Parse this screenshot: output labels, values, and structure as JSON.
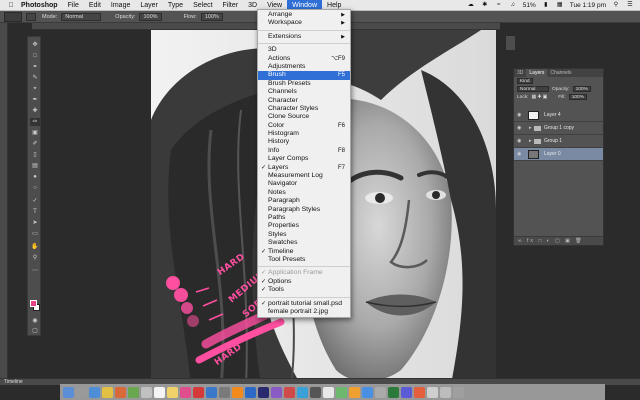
{
  "menubar": {
    "app_name": "Photoshop",
    "items": [
      "File",
      "Edit",
      "Image",
      "Layer",
      "Type",
      "Select",
      "Filter",
      "3D",
      "View",
      "Window",
      "Help"
    ],
    "battery": "51%",
    "clock": "Tue 1:19 pm"
  },
  "options_bar": {
    "mode_label": "Mode:",
    "mode_value": "Normal",
    "opacity_label": "Opacity:",
    "opacity_value": "100%",
    "flow_label": "Flow:",
    "flow_value": "100%"
  },
  "window_menu": {
    "rows": [
      {
        "label": "Arrange",
        "arrow": true
      },
      {
        "label": "Workspace",
        "arrow": true
      },
      {
        "sep": true
      },
      {
        "label": "Extensions",
        "arrow": true
      },
      {
        "sep": true
      },
      {
        "label": "3D"
      },
      {
        "label": "Actions",
        "shortcut": "⌥F9"
      },
      {
        "label": "Adjustments"
      },
      {
        "label": "Brush",
        "shortcut": "F5",
        "highlighted": true
      },
      {
        "label": "Brush Presets"
      },
      {
        "label": "Channels"
      },
      {
        "label": "Character"
      },
      {
        "label": "Character Styles"
      },
      {
        "label": "Clone Source"
      },
      {
        "label": "Color",
        "shortcut": "F6"
      },
      {
        "label": "Histogram"
      },
      {
        "label": "History"
      },
      {
        "label": "Info",
        "shortcut": "F8"
      },
      {
        "label": "Layer Comps"
      },
      {
        "label": "Layers",
        "shortcut": "F7",
        "checked": true
      },
      {
        "label": "Measurement Log"
      },
      {
        "label": "Navigator"
      },
      {
        "label": "Notes"
      },
      {
        "label": "Paragraph"
      },
      {
        "label": "Paragraph Styles"
      },
      {
        "label": "Paths"
      },
      {
        "label": "Properties"
      },
      {
        "label": "Styles"
      },
      {
        "label": "Swatches"
      },
      {
        "label": "Timeline",
        "checked": true
      },
      {
        "label": "Tool Presets"
      },
      {
        "sep": true
      },
      {
        "label": "Application Frame",
        "checked": true,
        "disabled": true
      },
      {
        "label": "Options",
        "checked": true
      },
      {
        "label": "Tools",
        "checked": true
      },
      {
        "sep": true
      },
      {
        "label": "portrait tutorial small.psd",
        "checked": true
      },
      {
        "label": "female portrait 2.jpg"
      }
    ]
  },
  "layers_panel": {
    "tabs": [
      "3D",
      "Layers",
      "Channels"
    ],
    "kind": "Kind",
    "blend_mode": "Normal",
    "opacity_label": "Opacity:",
    "opacity_value": "100%",
    "lock_label": "Lock:",
    "fill_label": "Fill:",
    "fill_value": "100%",
    "layers": [
      {
        "name": "Layer 4",
        "type": "layer"
      },
      {
        "name": "Group 1 copy",
        "type": "group"
      },
      {
        "name": "Group 1",
        "type": "group"
      },
      {
        "name": "Layer 0",
        "type": "image",
        "selected": true
      }
    ],
    "footer": "∞ fx □ ◐ ▢ ▣ 🗑"
  },
  "canvas_annotations": {
    "hard": "HARD",
    "medium": "MEDIUM",
    "soft": "SOFT",
    "hard2": "HARD"
  },
  "timeline": {
    "label": "Timeline"
  },
  "colors": {
    "accent": "#2f6fd6",
    "foreground_swatch": "#e8428a",
    "annotation": "#ff4fa0"
  }
}
